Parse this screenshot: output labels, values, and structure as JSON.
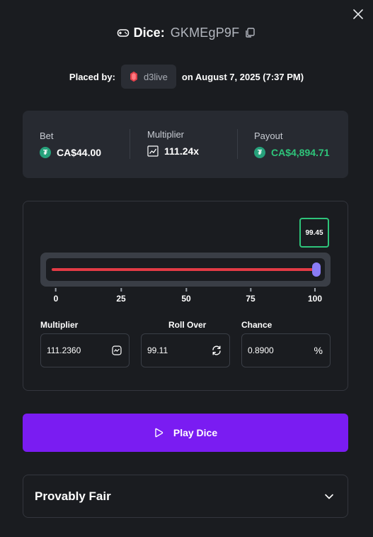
{
  "header": {
    "game": "Dice:",
    "bet_id": "GKMEgP9F",
    "placed_by_label": "Placed by:",
    "username": "d3live",
    "placed_on": "on August 7, 2025 (7:37 PM)"
  },
  "summary": {
    "bet_label": "Bet",
    "bet_value": "CA$44.00",
    "multiplier_label": "Multiplier",
    "multiplier_value": "111.24x",
    "payout_label": "Payout",
    "payout_value": "CA$4,894.71",
    "payout_color": "#2ec47a",
    "currency_icon": "tether-icon",
    "multiplier_icon": "trend-chart-icon"
  },
  "game": {
    "result": "99.45",
    "roll_over_fraction": 0.9911,
    "result_fraction": 0.9945,
    "ticks": [
      "0",
      "25",
      "50",
      "75",
      "100"
    ],
    "lose_color": "#e23b45",
    "win_color": "#2ec47a",
    "fields": {
      "multiplier_label": "Multiplier",
      "multiplier_value": "111.2360",
      "roll_over_label": "Roll Over",
      "roll_over_value": "99.11",
      "chance_label": "Chance",
      "chance_value": "0.8900",
      "chance_unit": "%"
    }
  },
  "play_button": {
    "label": "Play Dice",
    "color": "#7a1cf2"
  },
  "provably_fair": {
    "label": "Provably Fair"
  }
}
